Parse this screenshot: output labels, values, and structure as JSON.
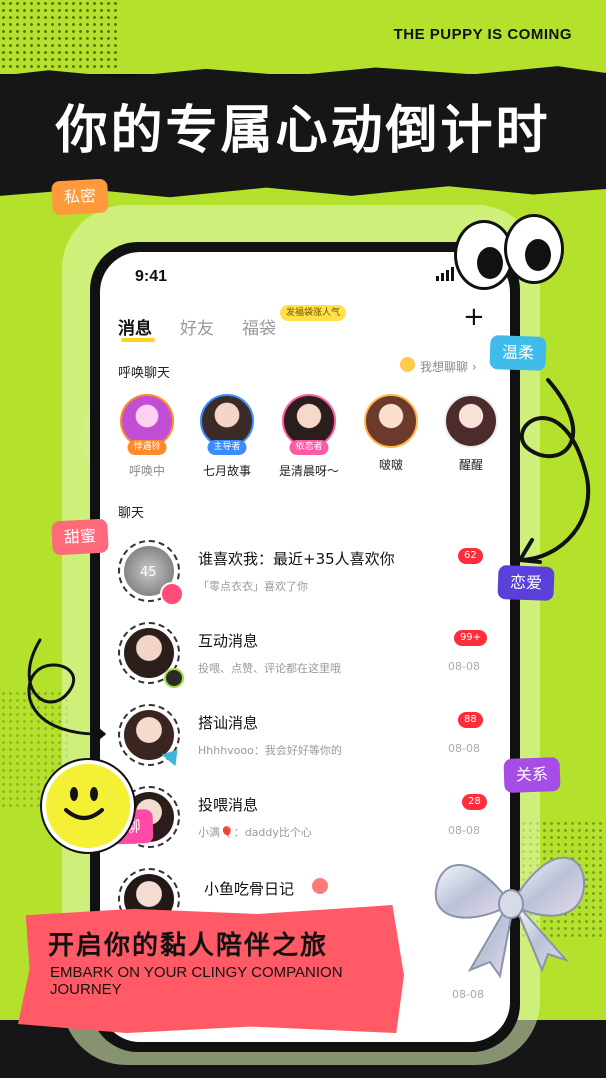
{
  "poster": {
    "slogan": "THE PUPPY IS COMING",
    "headline": "你的专属心动倒计时",
    "cta_title": "开启你的黏人陪伴之旅",
    "cta_subtitle": "EMBARK ON YOUR CLINGY COMPANION JOURNEY",
    "stickers": {
      "private": "私密",
      "gentle": "温柔",
      "sweet": "甜蜜",
      "love": "恋爱",
      "relation": "关系",
      "hi": "hi聊"
    }
  },
  "status_bar": {
    "time": "9:41"
  },
  "tabs": [
    {
      "label": "消息",
      "active": true
    },
    {
      "label": "好友",
      "active": false
    },
    {
      "label": "福袋",
      "active": false,
      "badge": "发福袋涨人气"
    }
  ],
  "summon": {
    "title": "呼唤聊天",
    "want_chat": "我想聊聊",
    "stories": [
      {
        "tag": "悸遇铃",
        "name": "呼唤中",
        "tag_color": "#ff8a2a"
      },
      {
        "tag": "主导者",
        "name": "七月故事",
        "tag_color": "#3a8dff"
      },
      {
        "tag": "依恋者",
        "name": "是清晨呀～",
        "tag_color": "#ff5aa5"
      },
      {
        "tag": "",
        "name": "啵啵",
        "tag_color": ""
      },
      {
        "tag": "",
        "name": "醒醒",
        "tag_color": ""
      }
    ]
  },
  "chat": {
    "title": "聊天",
    "rows": [
      {
        "title": "谁喜欢我：最近+35人喜欢你",
        "sub": "「零点衣衣」喜欢了你",
        "time": "",
        "badge": "62",
        "avatar_text": "45"
      },
      {
        "title": "互动消息",
        "sub": "投喂、点赞、评论都在这里哦",
        "time": "08-08",
        "badge": "99+"
      },
      {
        "title": "搭讪消息",
        "sub": "Hhhhvooo：我会好好等你的",
        "time": "08-08",
        "badge": "88"
      },
      {
        "title": "投喂消息",
        "sub": "小满🎈：daddy比个心",
        "time": "08-08",
        "badge": "28"
      },
      {
        "title": "小鱼吃骨日记",
        "sub": "",
        "time": "08-08",
        "badge": ""
      }
    ]
  },
  "colors": {
    "accent_green": "#b4e22c",
    "badge_red": "#ff2d3b",
    "tab_yellow": "#ffd21f"
  }
}
